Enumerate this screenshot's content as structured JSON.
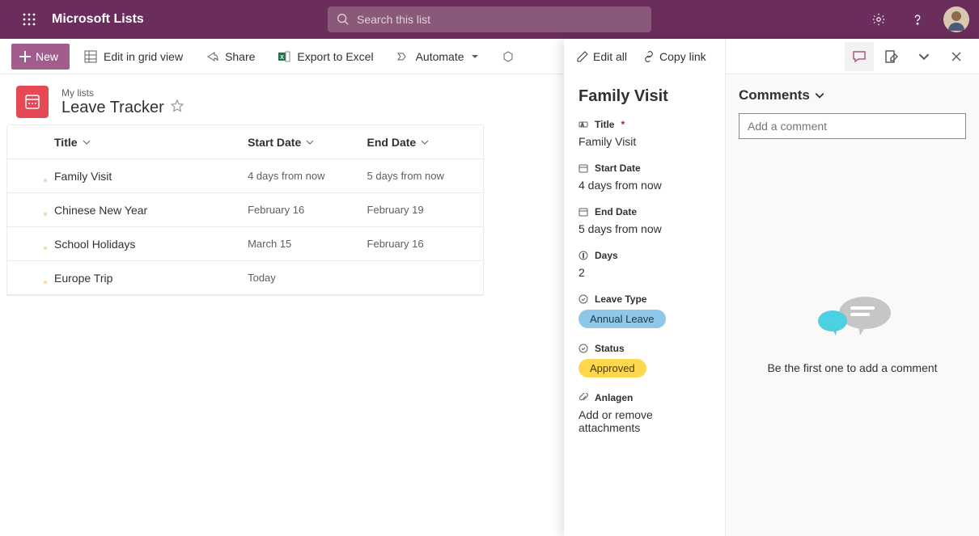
{
  "header": {
    "app_name": "Microsoft Lists",
    "search_placeholder": "Search this list"
  },
  "toolbar": {
    "new_label": "New",
    "edit_grid_label": "Edit in grid view",
    "share_label": "Share",
    "export_label": "Export to Excel",
    "automate_label": "Automate"
  },
  "list_header": {
    "breadcrumb": "My lists",
    "name": "Leave Tracker"
  },
  "columns": {
    "title": "Title",
    "start": "Start Date",
    "end": "End Date"
  },
  "rows": [
    {
      "title": "Family Visit",
      "start": "4 days from now",
      "end": "5 days from now"
    },
    {
      "title": "Chinese New Year",
      "start": "February 16",
      "end": "February 19"
    },
    {
      "title": "School Holidays",
      "start": "March 15",
      "end": "February 16"
    },
    {
      "title": "Europe Trip",
      "start": "Today",
      "end": ""
    }
  ],
  "panel_actions": {
    "edit_all": "Edit all",
    "copy_link": "Copy link"
  },
  "details": {
    "title": "Family Visit",
    "fields": {
      "title_label": "Title",
      "title_value": "Family Visit",
      "start_label": "Start Date",
      "start_value": "4 days from now",
      "end_label": "End Date",
      "end_value": "5 days from now",
      "days_label": "Days",
      "days_value": "2",
      "leave_type_label": "Leave Type",
      "leave_type_value": "Annual Leave",
      "status_label": "Status",
      "status_value": "Approved",
      "attach_label": "Anlagen",
      "attach_value": "Add or remove attachments"
    }
  },
  "comments": {
    "heading": "Comments",
    "placeholder": "Add a comment",
    "empty_text": "Be the first one to add a comment"
  }
}
